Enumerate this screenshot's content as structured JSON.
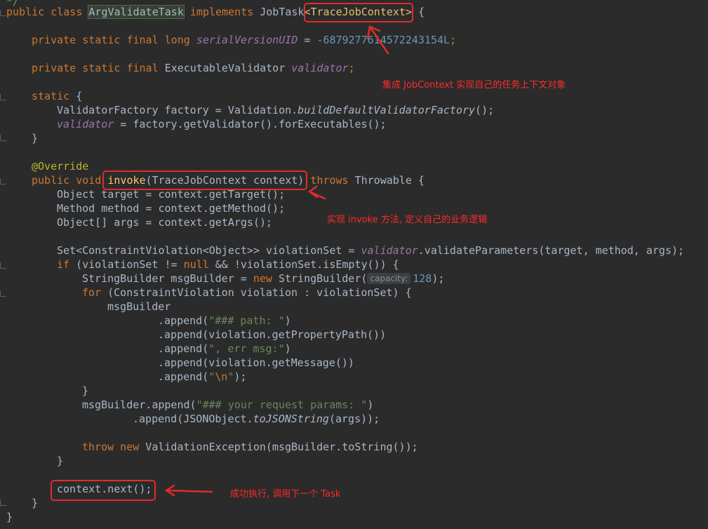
{
  "editor": {
    "top_comment": "*/",
    "lines": {
      "class_decl": {
        "kw": "public class ",
        "name": "ArgValidateTask",
        "kw2": " implements ",
        "iface": "JobTask",
        "generic": "<TraceJobContext>",
        "tail": " {"
      },
      "serial": {
        "kw": "private static final long ",
        "name": "serialVersionUID",
        "eq": " = ",
        "value": "-6879277614572243154L",
        "tail": ";"
      },
      "validator_decl": {
        "kw": "private static final ",
        "type": "ExecutableValidator ",
        "name": "validator",
        "tail": ";"
      },
      "static_open": {
        "kw": "static",
        "tail": " {"
      },
      "factory": {
        "text": "ValidatorFactory factory = Validation.",
        "call": "buildDefaultValidatorFactory",
        "tail": "();"
      },
      "validator_assign": {
        "name": "validator",
        "tail": " = factory.getValidator().forExecutables();"
      },
      "close_brace": "}",
      "override": "@Override",
      "invoke_decl": {
        "kw": "public void ",
        "name": "invoke",
        "params": "(TraceJobContext context)",
        "kw2": " throws ",
        "tail": "Throwable {"
      },
      "target": "Object target = context.getTarget();",
      "method": "Method method = context.getMethod();",
      "args": "Object[] args = context.getArgs();",
      "violation_set": {
        "text": "Set<ConstraintViolation<Object>> violationSet = ",
        "field": "validator",
        "tail": ".validateParameters(target, method, args);"
      },
      "if_line": {
        "kw": "if",
        "a": " (violationSet != ",
        "kw2": "null",
        "b": " && !violationSet.isEmpty()) {"
      },
      "sb_line": {
        "a": "StringBuilder msgBuilder = ",
        "kw": "new",
        "b": " StringBuilder(",
        "hint": "capacity:",
        "num": "128",
        "c": ");"
      },
      "for_line": {
        "kw": "for",
        "text": " (ConstraintViolation violation : violationSet) {"
      },
      "msg_builder": "msgBuilder",
      "append_path": {
        "a": ".append(",
        "s": "\"### path: \"",
        "b": ")"
      },
      "append_prop": ".append(violation.getPropertyPath())",
      "append_err": {
        "a": ".append(",
        "s": "\", err msg:\"",
        "b": ")"
      },
      "append_msg": ".append(violation.getMessage())",
      "append_nl": {
        "a": ".append(",
        "s1": "\"",
        "esc": "\\n",
        "s2": "\"",
        "b": ");"
      },
      "append_params": {
        "a": "msgBuilder.append(",
        "s": "\"### your request params: \"",
        "b": ")"
      },
      "append_json": {
        "a": ".append(JSONObject.",
        "call": "toJSONString",
        "b": "(args));"
      },
      "throw_line": {
        "kw": "throw",
        "kw2": " new",
        "text": " ValidationException(msgBuilder.toString());"
      },
      "next_line": "context.next();"
    }
  },
  "annotations": {
    "note1": "集成 JobContext 实现自己的任务上下文对象",
    "note2": "实现 invoke 方法, 定义自己的业务逻辑",
    "note3": "成功执行, 调用下一个 Task"
  },
  "colors": {
    "background": "#2b2b2b",
    "keyword": "#cc7832",
    "string": "#6a8759",
    "number": "#6897bb",
    "field": "#9876aa",
    "method_decl": "#ffc66d",
    "annotation": "#bbb529",
    "text": "#a9b7c6",
    "red_markup": "#e32b2b"
  }
}
